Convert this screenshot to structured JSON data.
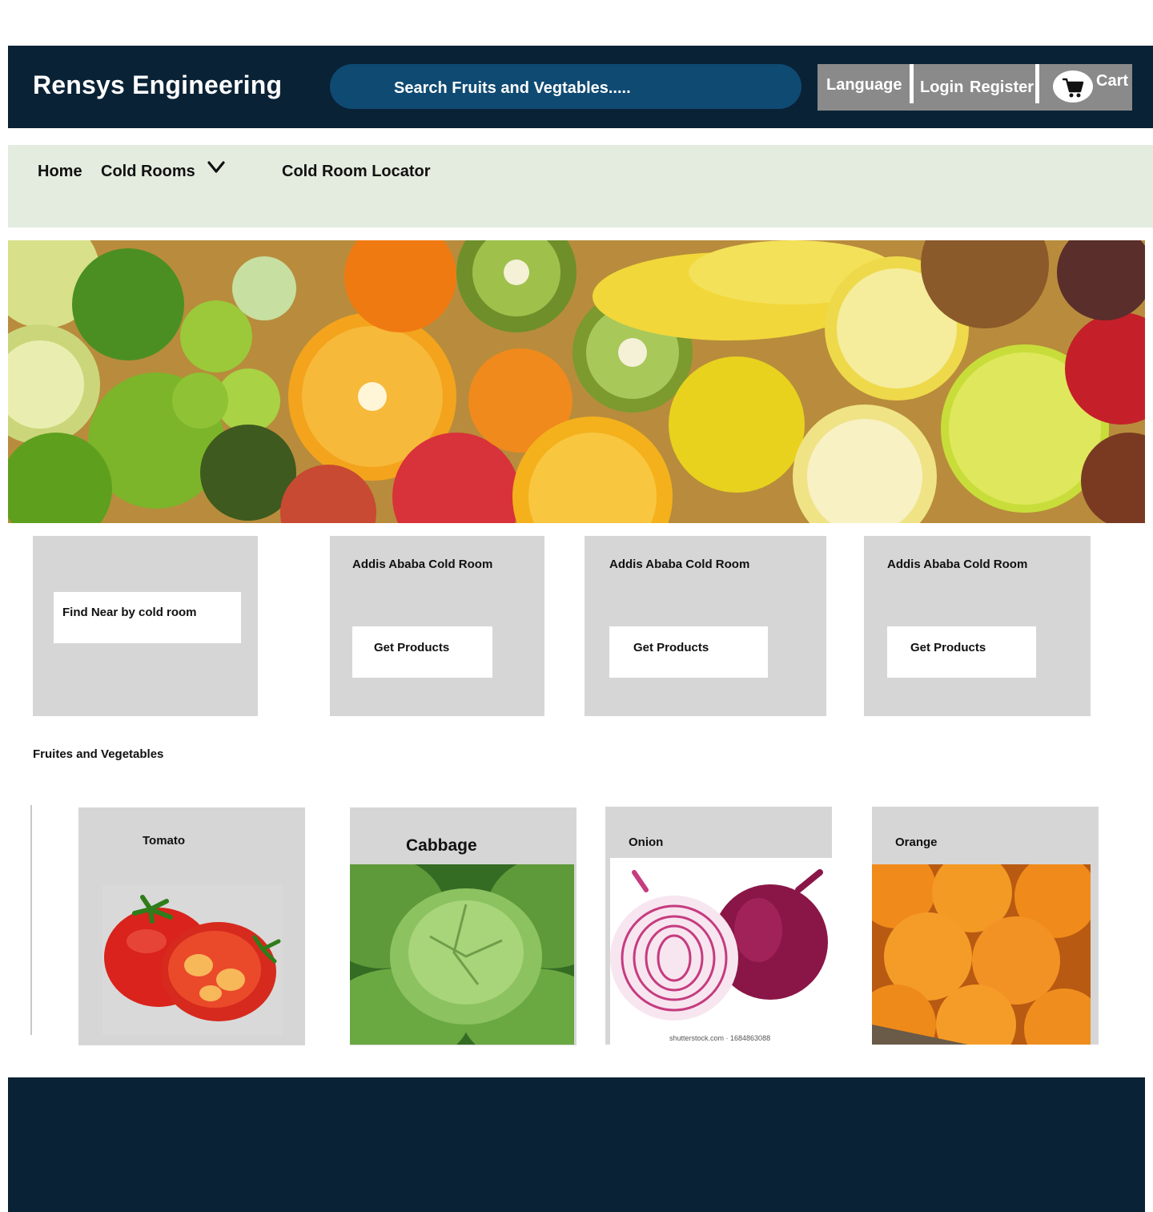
{
  "header": {
    "brand": "Rensys Engineering",
    "search_placeholder": "Search Fruits and Vegtables.....",
    "language": "Language",
    "login": "Login",
    "register": "Register",
    "cart": "Cart"
  },
  "nav": {
    "items": [
      "Home",
      "Cold Rooms",
      "Cold Room Locator"
    ]
  },
  "cold_rooms": {
    "finder_label": "Find Near by cold room",
    "cards": [
      {
        "title": "Addis Ababa Cold Room",
        "button": "Get Products"
      },
      {
        "title": "Addis Ababa Cold Room",
        "button": "Get Products"
      },
      {
        "title": "Addis Ababa Cold Room",
        "button": "Get Products"
      }
    ]
  },
  "products": {
    "section_title": "Fruites and Vegetables",
    "items": [
      {
        "name": "Tomato",
        "icon": "tomato-image"
      },
      {
        "name": "Cabbage",
        "icon": "cabbage-image"
      },
      {
        "name": "Onion",
        "icon": "onion-image",
        "watermark": "shutterstock.com · 1684863088"
      },
      {
        "name": "Orange",
        "icon": "orange-image"
      }
    ]
  },
  "colors": {
    "header_bg": "#0a2236",
    "search_bg": "#0f4a72",
    "nav_bg": "#e3ecdf",
    "card_bg": "#d6d6d6",
    "util_bg": "#8a8a8a"
  }
}
